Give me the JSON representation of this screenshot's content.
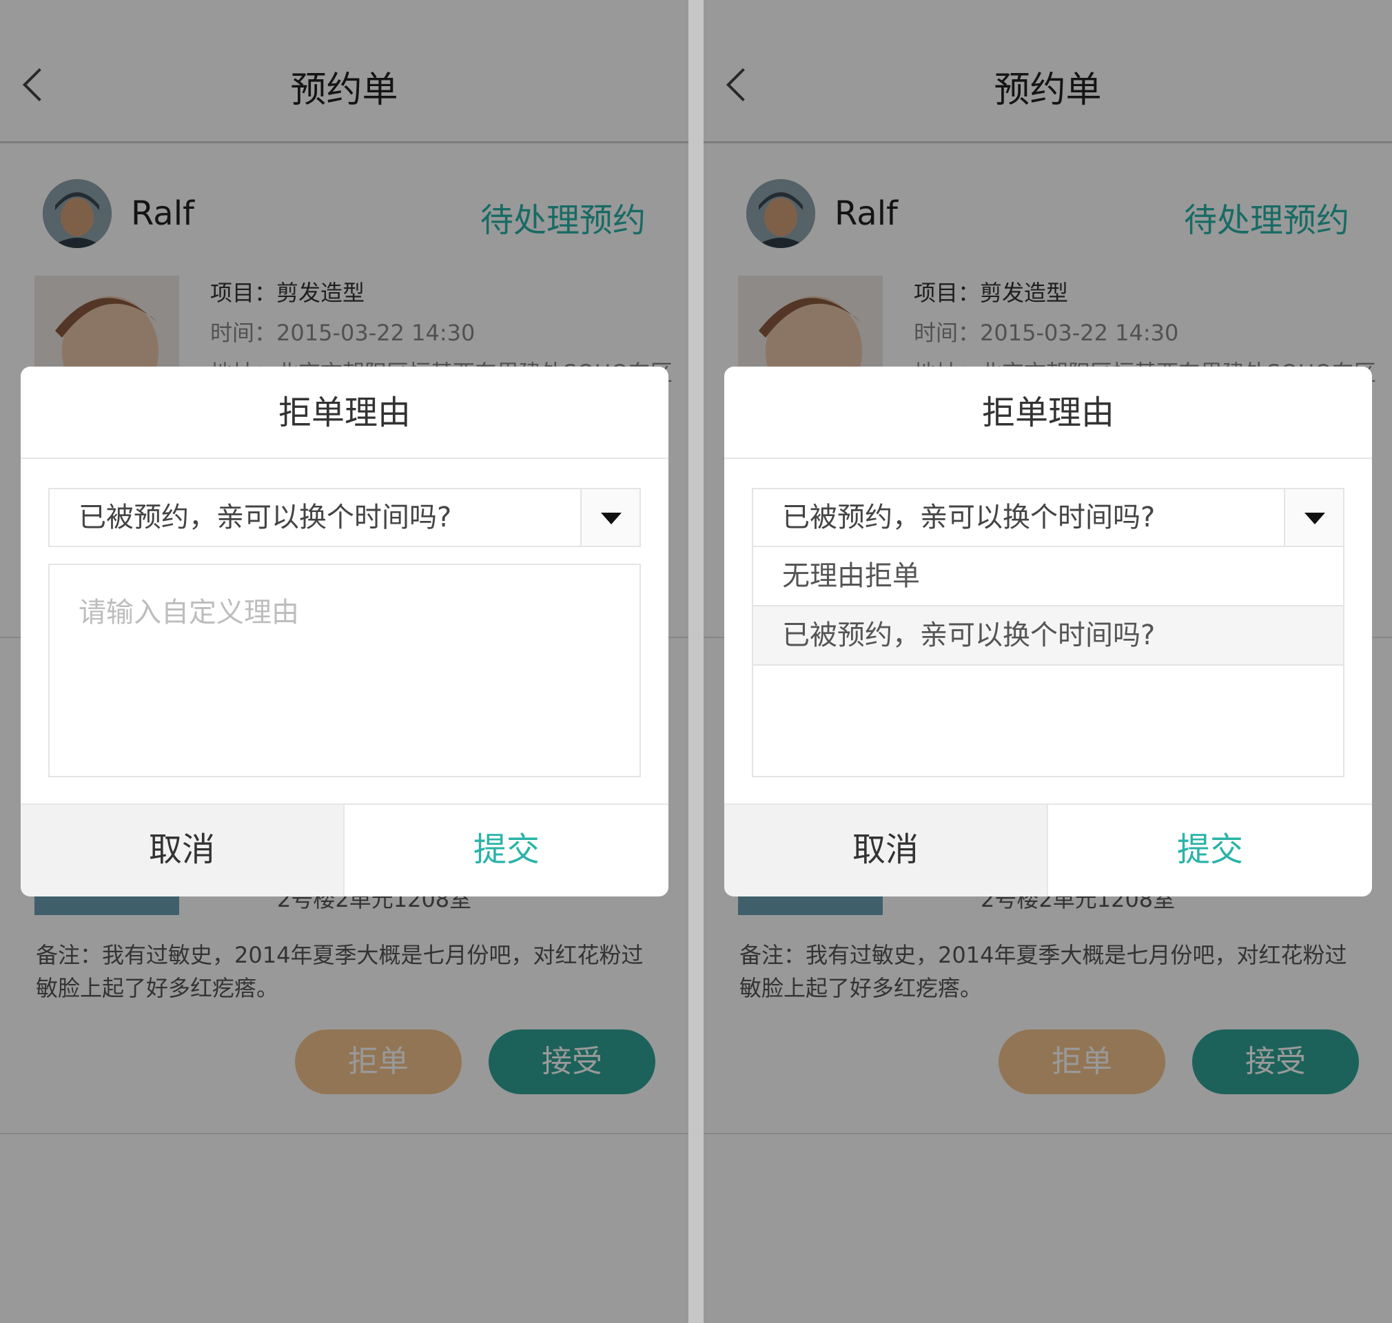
{
  "page": {
    "back_icon": "chevron-left-icon",
    "title": "预约单"
  },
  "user": {
    "name": "Ralf",
    "status": "待处理预约"
  },
  "order": {
    "project": "项目：剪发造型",
    "time": "时间：2015-03-22  14:30",
    "address_partial": "地址：北京市朝阳区恒基西东里建外SOHO东区",
    "address_line2": "2号楼2单元1208室",
    "remark": "备注：我有过敏史，2014年夏季大概是七月份吧，对红花粉过敏脸上起了好多红疙瘩。"
  },
  "actions": {
    "reject": "拒单",
    "accept": "接受"
  },
  "modal": {
    "title": "拒单理由",
    "selected_reason": "已被预约，亲可以换个时间吗?",
    "custom_placeholder": "请输入自定义理由",
    "options": [
      "无理由拒单",
      "已被预约，亲可以换个时间吗?"
    ],
    "cancel": "取消",
    "submit": "提交"
  },
  "colors": {
    "accent": "#29b3a7",
    "reject_button": "#f4c48d",
    "accept_button": "#2fa496",
    "overlay": "rgba(0,0,0,0.4)"
  }
}
